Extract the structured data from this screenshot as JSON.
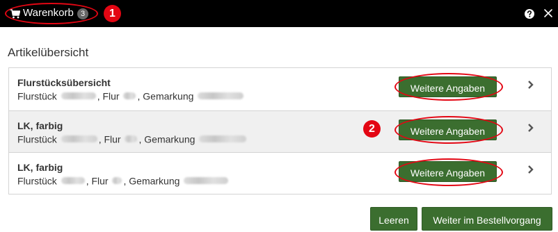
{
  "window": {
    "title": "Warenkorb",
    "badge_count": "3",
    "icons": [
      "cart-icon",
      "help-icon",
      "close-icon"
    ]
  },
  "annotations": {
    "marker_1": "1",
    "marker_2": "2"
  },
  "section_title": "Artikelübersicht",
  "items": [
    {
      "title": "Flurstücksübersicht",
      "parcel_label": "Flurstück",
      "flur_label": "Flur",
      "gemarkung_label": "Gemarkung",
      "button_label": "Weitere Angaben"
    },
    {
      "title": "LK, farbig",
      "parcel_label": "Flurstück",
      "flur_label": "Flur",
      "gemarkung_label": "Gemarkung",
      "button_label": "Weitere Angaben"
    },
    {
      "title": "LK, farbig",
      "parcel_label": "Flurstück",
      "flur_label": "Flur",
      "gemarkung_label": "Gemarkung",
      "button_label": "Weitere Angaben"
    }
  ],
  "footer": {
    "clear_label": "Leeren",
    "continue_label": "Weiter im Bestellvorgang"
  },
  "colors": {
    "titlebar": "#000000",
    "button_green": "#3b6e2f",
    "annotation_red": "#e30613",
    "selected_row": "#f0f0f0"
  }
}
